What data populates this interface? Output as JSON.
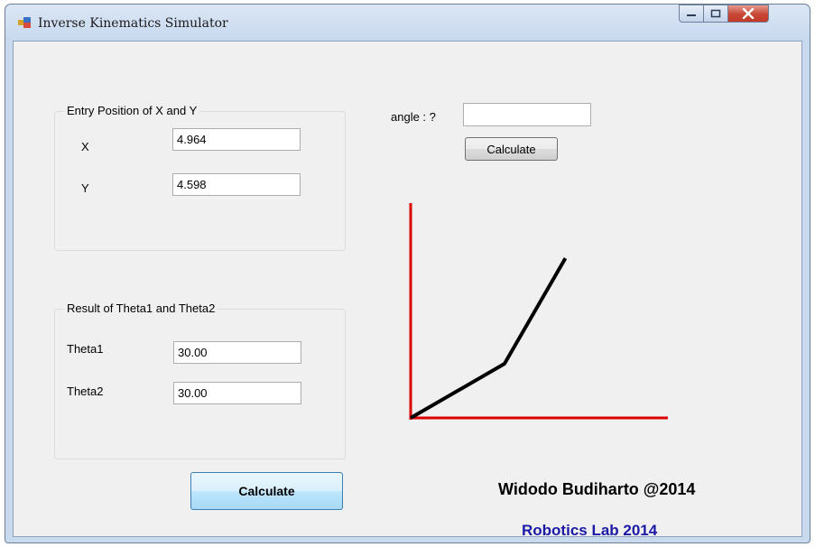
{
  "window": {
    "title": "Inverse Kinematics Simulator",
    "buttons": [
      "minimize",
      "maximize",
      "close"
    ]
  },
  "entry_group": {
    "legend": "Entry Position of X and  Y",
    "x_label": "X",
    "x_value": "4.964",
    "y_label": "Y",
    "y_value": "4.598"
  },
  "result_group": {
    "legend": "Result of Theta1 and Theta2",
    "theta1_label": "Theta1",
    "theta1_value": "30.00",
    "theta2_label": "Theta2",
    "theta2_value": "30.00"
  },
  "angle": {
    "label": "angle : ?",
    "value": "",
    "calculate_label": "Calculate"
  },
  "main_calculate_label": "Calculate",
  "arm_plot": {
    "theta1_deg": 30,
    "theta2_deg": 30,
    "axis_color": "#dd0000",
    "arm_color": "#000000"
  },
  "credits": {
    "author": "Widodo Budiharto @2014",
    "lab": "Robotics Lab 2014",
    "lab_color": "#1a1aa6"
  }
}
